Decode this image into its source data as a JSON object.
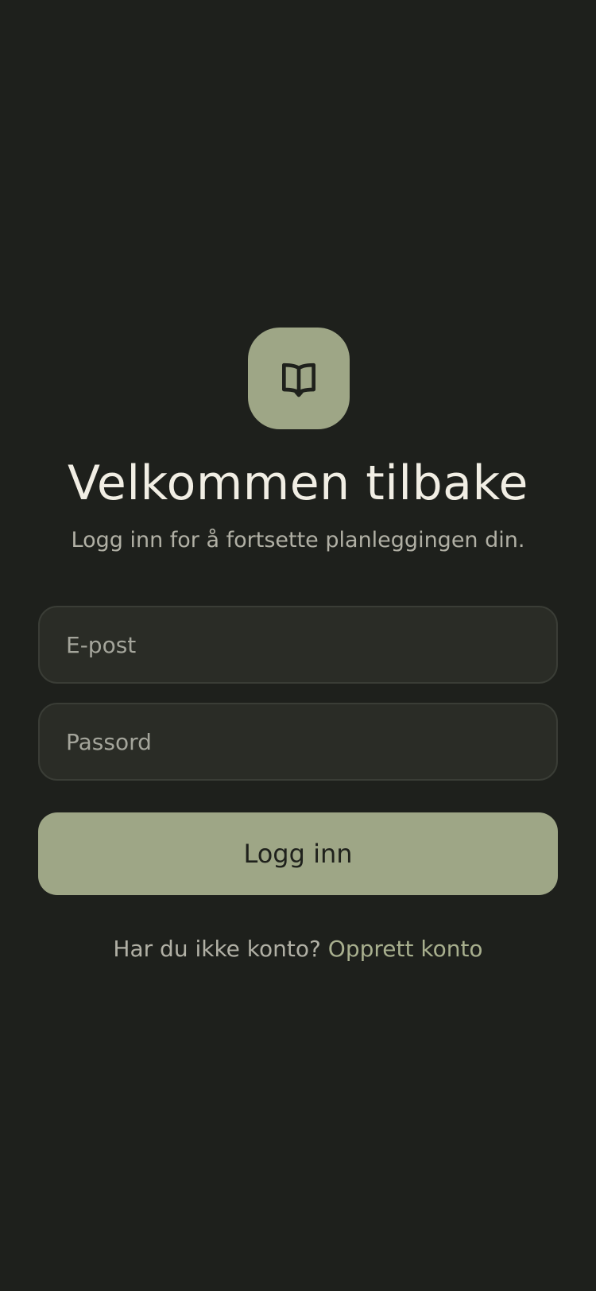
{
  "app": {
    "logo_icon": "open-book-icon",
    "accent_color": "#9ea686",
    "background_color": "#1e201c"
  },
  "header": {
    "title": "Velkommen tilbake",
    "subtitle": "Logg inn for å fortsette planleggingen din."
  },
  "form": {
    "email": {
      "value": "",
      "placeholder": "E-post"
    },
    "password": {
      "value": "",
      "placeholder": "Passord"
    },
    "submit_label": "Logg inn"
  },
  "footer": {
    "prompt": "Har du ikke konto?",
    "link_label": "Opprett konto"
  }
}
